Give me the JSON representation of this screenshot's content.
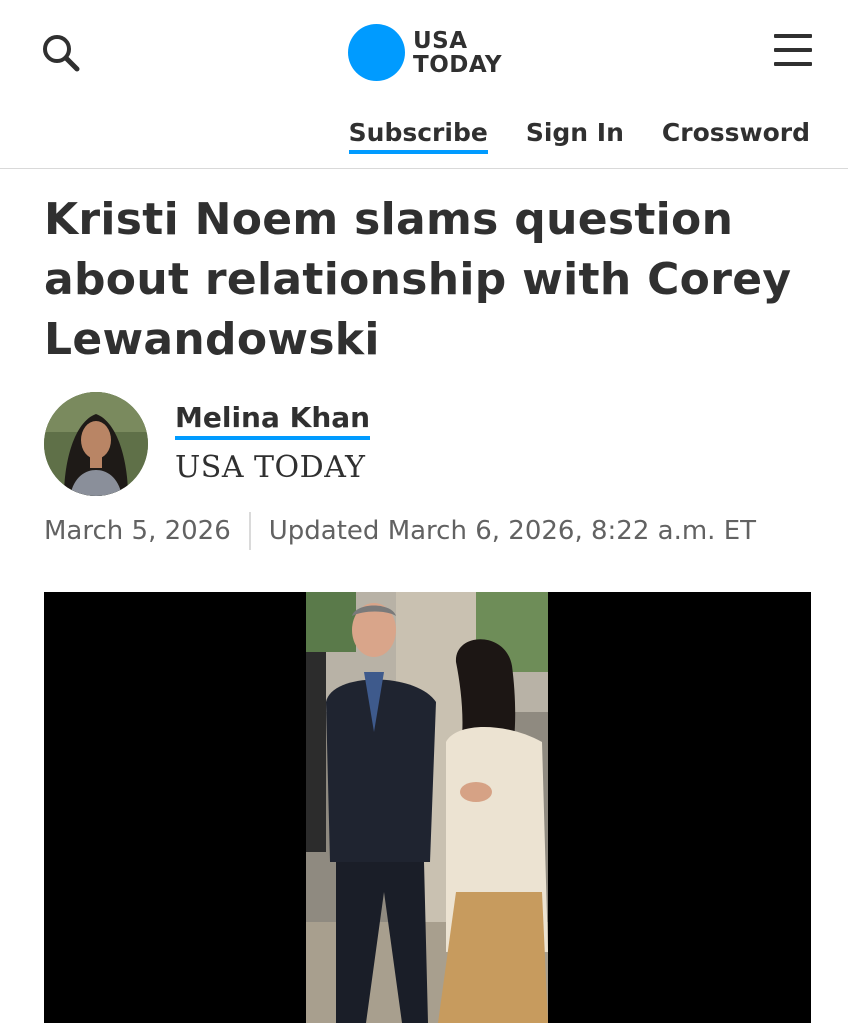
{
  "header": {
    "search_icon": "search-icon",
    "menu_icon": "hamburger-menu-icon",
    "logo": {
      "line1": "USA",
      "line2": "TODAY",
      "dot_color": "#009bff"
    },
    "nav": {
      "subscribe": "Subscribe",
      "sign_in": "Sign In",
      "crossword": "Crossword"
    }
  },
  "article": {
    "headline": "Kristi Noem slams question about relationship with Corey Lewandowski",
    "author": {
      "name": "Melina Khan",
      "organization": "USA TODAY"
    },
    "date": {
      "published": "March 5, 2026",
      "updated": "Updated March 6, 2026, 8:22 a.m. ET"
    }
  },
  "colors": {
    "accent": "#009bff",
    "text": "#303030",
    "muted": "#626262",
    "media_bg": "#000000"
  }
}
